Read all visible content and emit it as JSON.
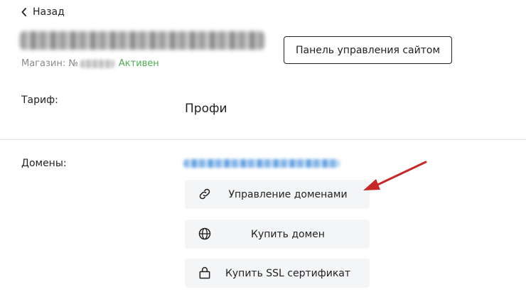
{
  "nav": {
    "back_label": "Назад"
  },
  "store": {
    "prefix": "Магазин: №",
    "status": "Активен",
    "status_color": "#4caf50"
  },
  "header": {
    "panel_button_label": "Панель управления сайтом"
  },
  "tariff": {
    "label": "Тариф:",
    "value": "Профи"
  },
  "domains": {
    "label": "Домены:",
    "actions": [
      {
        "label": "Управление доменами",
        "icon": "link-icon"
      },
      {
        "label": "Купить домен",
        "icon": "globe-icon"
      },
      {
        "label": "Купить SSL сертификат",
        "icon": "lock-icon"
      }
    ]
  },
  "colors": {
    "button_bg": "#f4f5f7",
    "arrow": "#c62828"
  }
}
